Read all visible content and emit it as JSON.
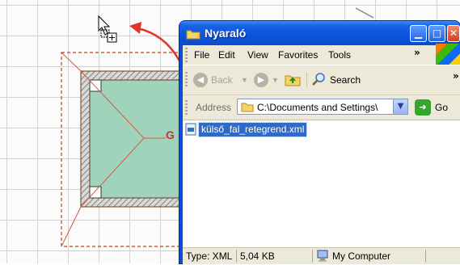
{
  "window": {
    "title": "Nyaraló"
  },
  "menu": [
    {
      "id": "file",
      "label": "File"
    },
    {
      "id": "edit",
      "label": "Edit"
    },
    {
      "id": "view",
      "label": "View"
    },
    {
      "id": "favorites",
      "label": "Favorites"
    },
    {
      "id": "tools",
      "label": "Tools"
    }
  ],
  "menu_overflow": "»",
  "toolbar": {
    "back_label": "Back",
    "search_label": "Search",
    "overflow": "»"
  },
  "address": {
    "label": "Address",
    "value": "C:\\Documents and Settings\\",
    "go_label": "Go"
  },
  "files": [
    {
      "name": "külső_fal_retegrend.xml",
      "selected": true
    }
  ],
  "status": {
    "type_info": "Type: XML",
    "size": "5,04 KB",
    "zone": "My Computer"
  },
  "cad": {
    "label": "G"
  },
  "colors": {
    "title_blue": "#0b55db",
    "selection": "#316ac5",
    "window_face": "#ece9d8",
    "room_fill": "#9fd3bc",
    "drag_arrow": "#e0332a",
    "dashed_outline": "#c0392b"
  },
  "icons": {
    "title": "folder-icon",
    "back": "back-arrow-icon",
    "forward": "forward-arrow-icon",
    "up": "up-folder-icon",
    "search": "search-icon",
    "address": "folder-icon",
    "go": "go-arrow-icon",
    "file": "xml-file-icon",
    "status_zone": "my-computer-icon",
    "cursor": "drag-copy-cursor-icon"
  }
}
